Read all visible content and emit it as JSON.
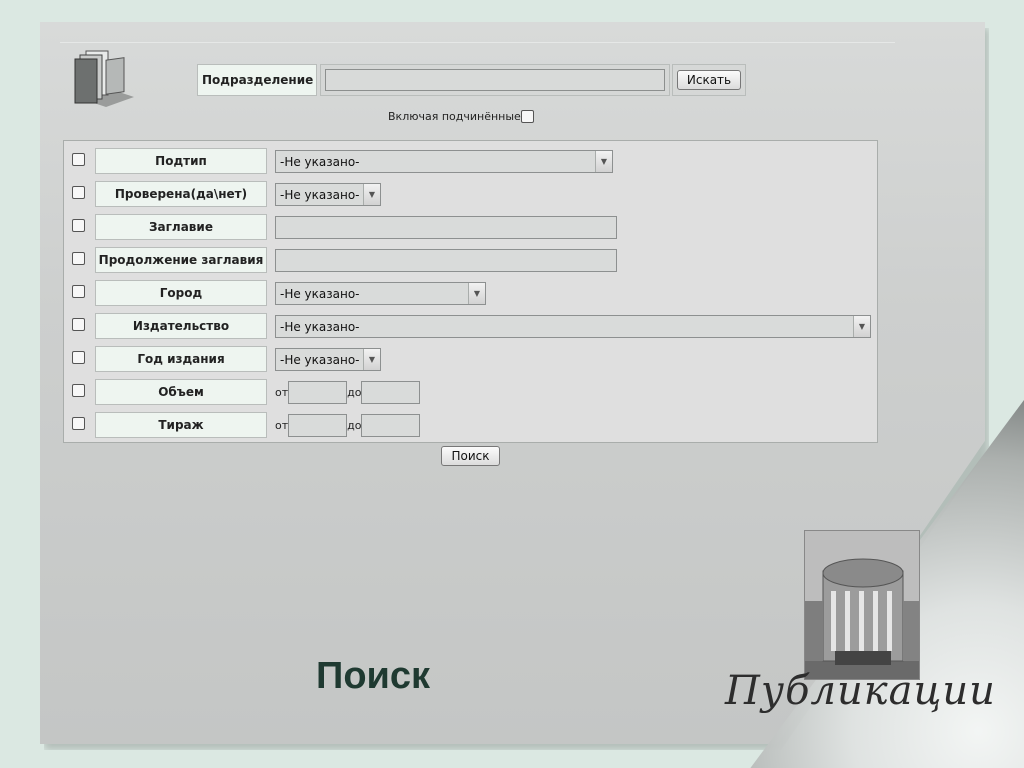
{
  "department": {
    "label": "Подразделение",
    "value": "",
    "button": "Искать"
  },
  "include_sub": {
    "label": "Включая подчинённые",
    "checked": false
  },
  "fields": [
    {
      "label": "Подтип",
      "control": "select",
      "value": "-Не указано-"
    },
    {
      "label": "Проверена(да\\нет)",
      "control": "select",
      "value": "-Не указано-"
    },
    {
      "label": "Заглавие",
      "control": "text",
      "value": ""
    },
    {
      "label": "Продолжение заглавия",
      "control": "text",
      "value": ""
    },
    {
      "label": "Город",
      "control": "select",
      "value": "-Не указано-"
    },
    {
      "label": "Издательство",
      "control": "select",
      "value": "-Не указано-"
    },
    {
      "label": "Год издания",
      "control": "select",
      "value": "-Не указано-"
    },
    {
      "label": "Объем",
      "control": "range",
      "from_label": "от",
      "to_label": "до"
    },
    {
      "label": "Тираж",
      "control": "range",
      "from_label": "от",
      "to_label": "до"
    }
  ],
  "search_button": "Поиск",
  "page_heading": "Поиск",
  "section_title": "Публикации",
  "icons": {
    "books": "books-icon",
    "dropdown": "chevron-down-icon",
    "photo": "building-photo"
  },
  "colors": {
    "background": "#dbe8e2",
    "label_bg": "#eef5f0",
    "heading": "#1f3a31"
  }
}
